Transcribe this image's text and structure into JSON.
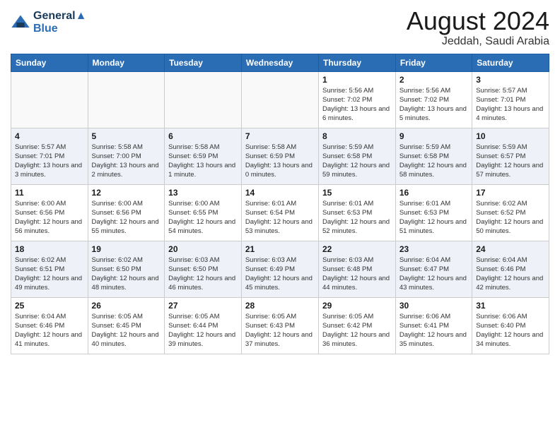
{
  "header": {
    "logo_line1": "General",
    "logo_line2": "Blue",
    "main_title": "August 2024",
    "subtitle": "Jeddah, Saudi Arabia"
  },
  "calendar": {
    "days_of_week": [
      "Sunday",
      "Monday",
      "Tuesday",
      "Wednesday",
      "Thursday",
      "Friday",
      "Saturday"
    ],
    "weeks": [
      [
        {
          "day": "",
          "info": ""
        },
        {
          "day": "",
          "info": ""
        },
        {
          "day": "",
          "info": ""
        },
        {
          "day": "",
          "info": ""
        },
        {
          "day": "1",
          "info": "Sunrise: 5:56 AM\nSunset: 7:02 PM\nDaylight: 13 hours and 6 minutes."
        },
        {
          "day": "2",
          "info": "Sunrise: 5:56 AM\nSunset: 7:02 PM\nDaylight: 13 hours and 5 minutes."
        },
        {
          "day": "3",
          "info": "Sunrise: 5:57 AM\nSunset: 7:01 PM\nDaylight: 13 hours and 4 minutes."
        }
      ],
      [
        {
          "day": "4",
          "info": "Sunrise: 5:57 AM\nSunset: 7:01 PM\nDaylight: 13 hours and 3 minutes."
        },
        {
          "day": "5",
          "info": "Sunrise: 5:58 AM\nSunset: 7:00 PM\nDaylight: 13 hours and 2 minutes."
        },
        {
          "day": "6",
          "info": "Sunrise: 5:58 AM\nSunset: 6:59 PM\nDaylight: 13 hours and 1 minute."
        },
        {
          "day": "7",
          "info": "Sunrise: 5:58 AM\nSunset: 6:59 PM\nDaylight: 13 hours and 0 minutes."
        },
        {
          "day": "8",
          "info": "Sunrise: 5:59 AM\nSunset: 6:58 PM\nDaylight: 12 hours and 59 minutes."
        },
        {
          "day": "9",
          "info": "Sunrise: 5:59 AM\nSunset: 6:58 PM\nDaylight: 12 hours and 58 minutes."
        },
        {
          "day": "10",
          "info": "Sunrise: 5:59 AM\nSunset: 6:57 PM\nDaylight: 12 hours and 57 minutes."
        }
      ],
      [
        {
          "day": "11",
          "info": "Sunrise: 6:00 AM\nSunset: 6:56 PM\nDaylight: 12 hours and 56 minutes."
        },
        {
          "day": "12",
          "info": "Sunrise: 6:00 AM\nSunset: 6:56 PM\nDaylight: 12 hours and 55 minutes."
        },
        {
          "day": "13",
          "info": "Sunrise: 6:00 AM\nSunset: 6:55 PM\nDaylight: 12 hours and 54 minutes."
        },
        {
          "day": "14",
          "info": "Sunrise: 6:01 AM\nSunset: 6:54 PM\nDaylight: 12 hours and 53 minutes."
        },
        {
          "day": "15",
          "info": "Sunrise: 6:01 AM\nSunset: 6:53 PM\nDaylight: 12 hours and 52 minutes."
        },
        {
          "day": "16",
          "info": "Sunrise: 6:01 AM\nSunset: 6:53 PM\nDaylight: 12 hours and 51 minutes."
        },
        {
          "day": "17",
          "info": "Sunrise: 6:02 AM\nSunset: 6:52 PM\nDaylight: 12 hours and 50 minutes."
        }
      ],
      [
        {
          "day": "18",
          "info": "Sunrise: 6:02 AM\nSunset: 6:51 PM\nDaylight: 12 hours and 49 minutes."
        },
        {
          "day": "19",
          "info": "Sunrise: 6:02 AM\nSunset: 6:50 PM\nDaylight: 12 hours and 48 minutes."
        },
        {
          "day": "20",
          "info": "Sunrise: 6:03 AM\nSunset: 6:50 PM\nDaylight: 12 hours and 46 minutes."
        },
        {
          "day": "21",
          "info": "Sunrise: 6:03 AM\nSunset: 6:49 PM\nDaylight: 12 hours and 45 minutes."
        },
        {
          "day": "22",
          "info": "Sunrise: 6:03 AM\nSunset: 6:48 PM\nDaylight: 12 hours and 44 minutes."
        },
        {
          "day": "23",
          "info": "Sunrise: 6:04 AM\nSunset: 6:47 PM\nDaylight: 12 hours and 43 minutes."
        },
        {
          "day": "24",
          "info": "Sunrise: 6:04 AM\nSunset: 6:46 PM\nDaylight: 12 hours and 42 minutes."
        }
      ],
      [
        {
          "day": "25",
          "info": "Sunrise: 6:04 AM\nSunset: 6:46 PM\nDaylight: 12 hours and 41 minutes."
        },
        {
          "day": "26",
          "info": "Sunrise: 6:05 AM\nSunset: 6:45 PM\nDaylight: 12 hours and 40 minutes."
        },
        {
          "day": "27",
          "info": "Sunrise: 6:05 AM\nSunset: 6:44 PM\nDaylight: 12 hours and 39 minutes."
        },
        {
          "day": "28",
          "info": "Sunrise: 6:05 AM\nSunset: 6:43 PM\nDaylight: 12 hours and 37 minutes."
        },
        {
          "day": "29",
          "info": "Sunrise: 6:05 AM\nSunset: 6:42 PM\nDaylight: 12 hours and 36 minutes."
        },
        {
          "day": "30",
          "info": "Sunrise: 6:06 AM\nSunset: 6:41 PM\nDaylight: 12 hours and 35 minutes."
        },
        {
          "day": "31",
          "info": "Sunrise: 6:06 AM\nSunset: 6:40 PM\nDaylight: 12 hours and 34 minutes."
        }
      ]
    ]
  }
}
